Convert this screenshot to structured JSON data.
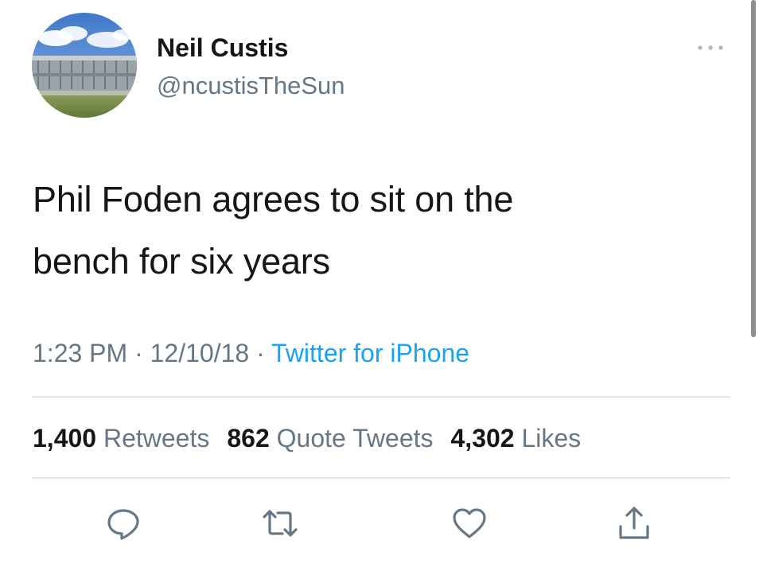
{
  "tweet": {
    "display_name": "Neil Custis",
    "handle": "@ncustisTheSun",
    "text_line_1": "Phil Foden agrees to sit on the",
    "text_line_2": "bench for six years",
    "time": "1:23 PM",
    "date": "12/10/18",
    "separator": "·",
    "source": "Twitter for iPhone"
  },
  "stats": {
    "retweets_count": "1,400",
    "retweets_label": "Retweets",
    "quotes_count": "862",
    "quotes_label": "Quote Tweets",
    "likes_count": "4,302",
    "likes_label": "Likes"
  },
  "icons": {
    "more": "more-horizontal-icon",
    "reply": "reply-icon",
    "retweet": "retweet-icon",
    "like": "heart-icon",
    "share": "share-icon"
  },
  "colors": {
    "text": "#14171a",
    "secondary": "#657786",
    "link": "#1da1f2",
    "divider": "#e1e8ed"
  }
}
